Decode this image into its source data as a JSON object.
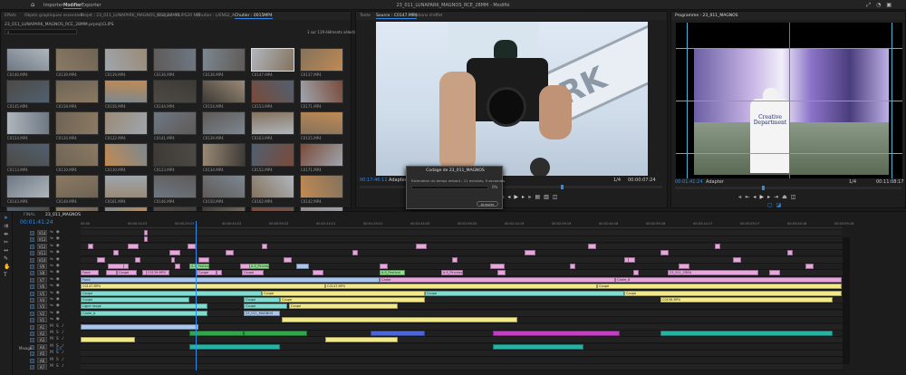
{
  "app": {
    "title": "23_011_LUNAPARK_MAGNOS_RCE_28MM - Modifié",
    "nav": [
      "Importer",
      "Modifier",
      "Exporter"
    ],
    "active_nav": "Modifier"
  },
  "project_panel": {
    "tabs": [
      "Effets",
      "Objets graphiques essentiels",
      "Projet : 23_011_LUNAPARK_MAGNOS_RCE_28MM",
      "Chutier : CLIPS20 NM",
      "Chutier : LIENS2_A",
      "Chutier : 0015MP4"
    ],
    "active_tab": "Chutier : 0015MP4",
    "path": "23_011_LUNAPARK_MAGNOS_RCE_28MM.prproj\\CLIPS",
    "count": "1 sur 119 éléments sélectionnés",
    "clips": [
      "C0140.MP4",
      "C0139.MP4",
      "C0139.MP4",
      "C0136.MP4",
      "C0136.MP4",
      "C0147.MP4",
      "C0137.MP4",
      "C0145.MP4",
      "C0158.MP4",
      "C0156.MP4",
      "C0144.MP4",
      "C0154.MP4",
      "C0153.MP4",
      "C0171.MP4",
      "C0154.MP4",
      "C0120.MP4",
      "C0122.MP4",
      "C0141.MP4",
      "C0139.MP4",
      "C0163.MP4",
      "C0125.MP4",
      "C0113.MP4",
      "C0110.MP4",
      "C0130.MP4",
      "C0123.MP4",
      "C0134.MP4",
      "C0152.MP4",
      "C0171.MP4",
      "C0143.MP4",
      "C0149.MP4",
      "C0161.MP4",
      "C0146.MP4",
      "C0150.MP4",
      "C0162.MP4",
      "C0142.MP4",
      "C0148.MP4",
      "C0155.MP4",
      "C0157.MP4",
      "C0159.MP4",
      "C0160.MP4",
      "C0164.MP4",
      "C0165.MP4"
    ],
    "colors": [
      "#6d7883",
      "#8b7a63",
      "#9fa6ae",
      "#5f5a58",
      "#7c8790",
      "#b0b6bd",
      "#84725d",
      "#4d4a46",
      "#6e6354",
      "#c08a52",
      "#3d3a36",
      "#9a8a76",
      "#506070",
      "#7a4a3a"
    ]
  },
  "source_monitor": {
    "tabs": [
      "Texte",
      "Source : C0147.MP4",
      "Options d'effet"
    ],
    "timecode_in": "00:17:46:11",
    "fit": "Adapter",
    "ratio": "1/4",
    "timecode_out": "00:00:07:24"
  },
  "program_monitor": {
    "tab": "Programme : 23_011_MAGNOS",
    "timecode_in": "00:01:41:24",
    "fit": "Adapter",
    "ratio": "1/4",
    "timecode_out": "00:11:08:17",
    "shirt_text": "Creative Department"
  },
  "encode_dialog": {
    "title": "Codage de 23_011_MAGNOS",
    "status": "Estimation du temps restant : 11 minutes, 9 secondes",
    "progress_pct": 0,
    "pct_label": "0%",
    "cancel": "Annuler"
  },
  "timeline": {
    "tab": "23_011_MAGNOS",
    "other_tab": "FINAL",
    "timecode": "00:01:41:24",
    "ruler_labels": [
      "00:00",
      "00:00:14:23",
      "00:00:29:23",
      "00:00:44:22",
      "00:00:59:22",
      "00:01:14:21",
      "00:01:29:21",
      "00:01:44:20",
      "00:01:59:20",
      "00:02:14:19",
      "00:02:29:19",
      "00:02:44:18",
      "00:02:59:18",
      "00:03:14:17",
      "00:03:29:17",
      "00:03:44:16",
      "00:03:59:16"
    ],
    "video_tracks": [
      "V14",
      "V13",
      "V12",
      "V11",
      "V10",
      "V9",
      "V8",
      "V7",
      "V6",
      "V5",
      "V4",
      "V3",
      "V2",
      "V1"
    ],
    "audio_tracks": [
      "A1",
      "A2",
      "A3",
      "A4",
      "A5",
      "A6",
      "A7"
    ],
    "mix_label": "Mixage",
    "mix_value": "0,0",
    "clip_labels": [
      "Fond",
      "Coupe",
      "C0139.MP4",
      "Coupe",
      "Coupe",
      "Fond",
      "C0147.MP4",
      "Coupe",
      "C0147.MP4",
      "Ligne rouge",
      "A.S_Festival",
      "A.S_Festival",
      "A.S_Pinceau",
      "Cadre",
      "Cadre_8",
      "Cadre_b",
      "23_011_CREA",
      "23_011_MAGNOS",
      "Coupe",
      "Coupe",
      "Coupe",
      "Coupe",
      "Coupe",
      "Coupe",
      "Coupe",
      "Coupe",
      "C0156.MP4",
      "Coupe"
    ],
    "colors": {
      "pink": "#e8a6df",
      "yellow": "#f2e98a",
      "cyan": "#7fdcd0",
      "lightblue": "#a9c7ee",
      "green": "#8fe08f",
      "audio_teal": "#27b3a3",
      "audio_green": "#2fa84a",
      "audio_magenta": "#c43ec4",
      "audio_blue": "#4a66d8",
      "accent": "#2d8ceb"
    }
  }
}
